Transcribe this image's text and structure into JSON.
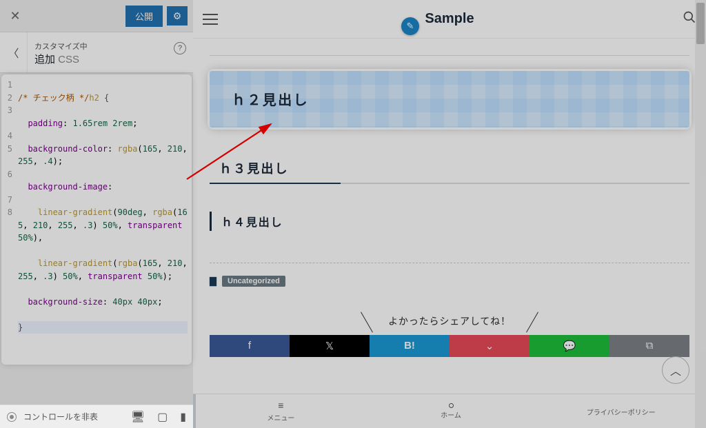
{
  "customizer": {
    "publish_label": "公開",
    "title_sub": "カスタマイズ中",
    "title_main": "追加 ",
    "title_css": "CSS",
    "hide_controls": "コントロールを非表",
    "code": {
      "line1_comment": "/* チェック柄 */",
      "line1_sel": "h2 ",
      "line1_brace": "{",
      "line2_prop": "padding",
      "line2_val_a": "1.65rem",
      "line2_val_b": "2rem",
      "line3_prop": "background-color",
      "line3_fn": "rgba",
      "line3_n1": "165",
      "line3_n2": "210",
      "line3_n3": "255",
      "line3_n4": ".4",
      "line4_prop": "background-image",
      "line5_fn": "linear-gradient",
      "line5_arg0": "90deg",
      "line5_rgba": "rgba",
      "line5_n1": "165",
      "line5_n2": "210",
      "line5_n3": "255",
      "line5_n4": ".3",
      "line5_p50": "50%",
      "line5_trans": "transparent",
      "line5_p50b": "50%",
      "line6_fn": "linear-gradient",
      "line6_rgba": "rgba",
      "line6_n1": "165",
      "line6_n2": "210",
      "line6_n3": "255",
      "line6_n4": ".3",
      "line6_p50": "50%",
      "line6_trans": "transparent",
      "line6_p50b": "50%",
      "line7_prop": "background-size",
      "line7_a": "40px",
      "line7_b": "40px",
      "line8": "}"
    },
    "gutter": [
      "1",
      "2",
      "3",
      "4",
      "5",
      "6",
      "7",
      "8"
    ]
  },
  "preview": {
    "site_title": "Sample",
    "h2": "ｈ２見出し",
    "h3": "ｈ３見出し",
    "h4": "ｈ４見出し",
    "category": "Uncategorized",
    "share_heading": "よかったらシェアしてね！",
    "share": {
      "b_label": "B!"
    },
    "tabs": {
      "menu": "メニュー",
      "home": "ホーム",
      "privacy": "プライバシーポリシー"
    }
  }
}
